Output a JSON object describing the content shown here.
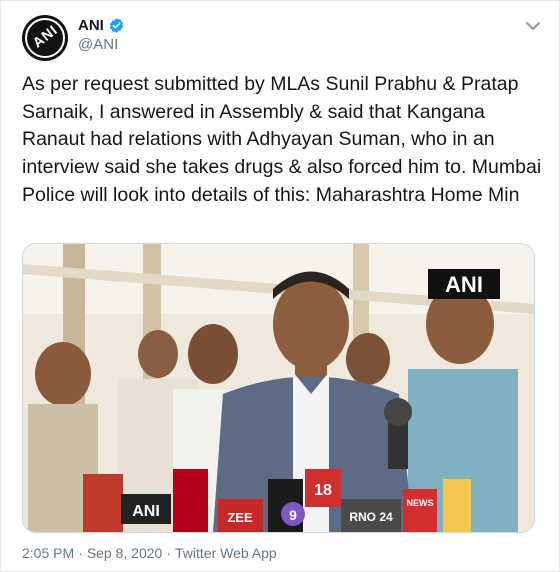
{
  "author": {
    "avatar_text": "ANI",
    "name": "ANI",
    "handle": "@ANI",
    "verified": true
  },
  "tweet": {
    "text": "As per request submitted by MLAs Sunil Prabhu & Pratap Sarnaik, I answered in Assembly & said that Kangana Ranaut had relations with Adhyayan Suman, who in an interview said she takes drugs & also forced him to. Mumbai Police will look into details of this: Maharashtra Home Min"
  },
  "media": {
    "watermark": "ANI",
    "mic_labels": [
      "ANI",
      "ZEE",
      "18",
      "RNO 24",
      "NEWS",
      "9"
    ]
  },
  "footer": {
    "time": "2:05 PM",
    "separator": "·",
    "date": "Sep 8, 2020",
    "source": "Twitter Web App"
  },
  "colors": {
    "verified": "#1da1f2",
    "meta_text": "#657786",
    "text": "#14171a"
  },
  "icons": {
    "verified": "verified-badge-icon",
    "menu": "chevron-down-icon"
  }
}
